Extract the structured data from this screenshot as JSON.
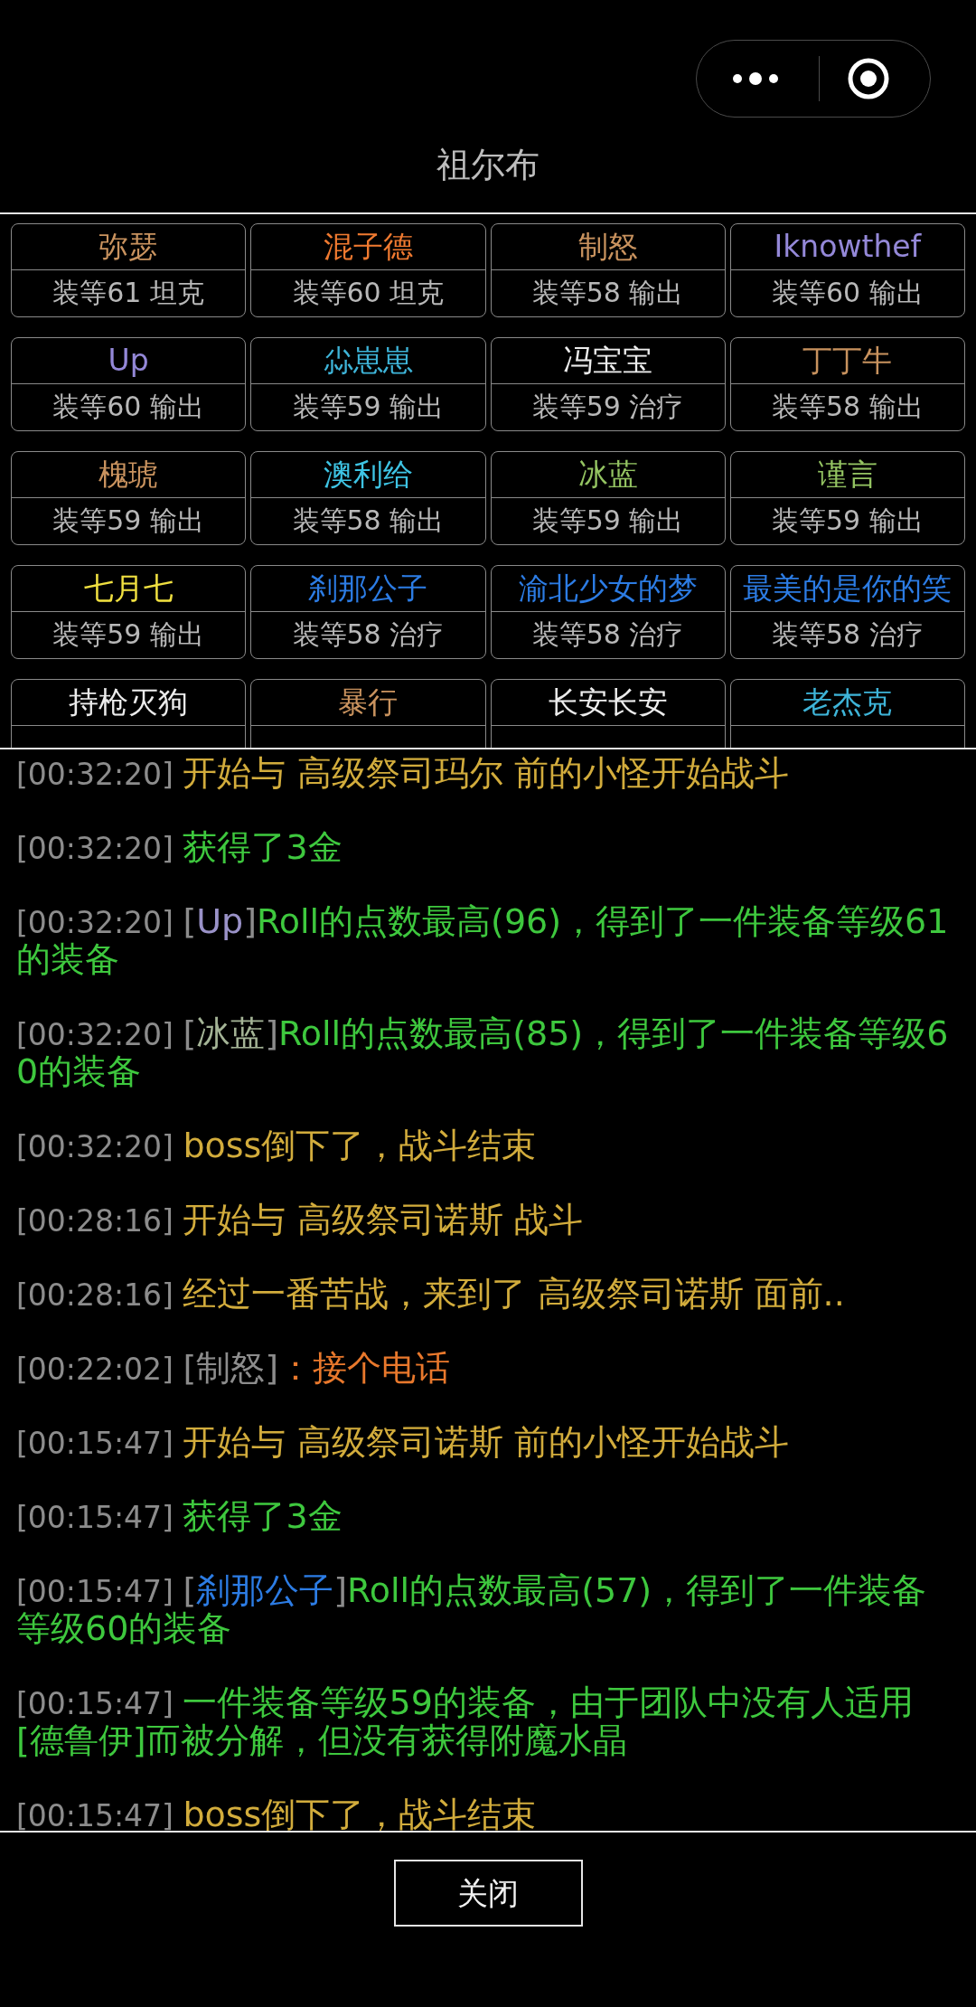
{
  "title": "祖尔布",
  "members": [
    {
      "name": "弥瑟",
      "color": "#c8925e",
      "info": "装等61 坦克"
    },
    {
      "name": "混子德",
      "color": "#f07a30",
      "info": "装等60 坦克"
    },
    {
      "name": "制怒",
      "color": "#c8925e",
      "info": "装等58 输出"
    },
    {
      "name": "Iknowthef",
      "color": "#9488d8",
      "info": "装等60 输出"
    },
    {
      "name": "Up",
      "color": "#9488d8",
      "info": "装等60 输出"
    },
    {
      "name": "尛崽崽",
      "color": "#3eb4d8",
      "info": "装等59 输出"
    },
    {
      "name": "冯宝宝",
      "color": "#ececec",
      "info": "装等59 治疗"
    },
    {
      "name": "丁丁牛",
      "color": "#c8925e",
      "info": "装等58 输出"
    },
    {
      "name": "槐琥",
      "color": "#c8925e",
      "info": "装等59 输出"
    },
    {
      "name": "澳利给",
      "color": "#3ec4e4",
      "info": "装等58 输出"
    },
    {
      "name": "冰蓝",
      "color": "#94c462",
      "info": "装等59 输出"
    },
    {
      "name": "谨言",
      "color": "#94c462",
      "info": "装等59 输出"
    },
    {
      "name": "七月七",
      "color": "#f0e040",
      "info": "装等59 输出"
    },
    {
      "name": "刹那公子",
      "color": "#2c7ce4",
      "info": "装等58 治疗"
    },
    {
      "name": "渝北少女的梦",
      "color": "#2c7ce4",
      "info": "装等58 治疗"
    },
    {
      "name": "最美的是你的笑",
      "color": "#2c7ce4",
      "info": "装等58 治疗"
    },
    {
      "name": "持枪灭狗",
      "color": "#ececec"
    },
    {
      "name": "暴行",
      "color": "#c8925e"
    },
    {
      "name": "长安长安",
      "color": "#ececec"
    },
    {
      "name": "老杰克",
      "color": "#3eb4d8"
    }
  ],
  "log": [
    {
      "time": "[00:32:20]",
      "parts": [
        {
          "text": "开始与 高级祭司玛尔 前的小怪开始战斗",
          "color": "#d2ac3c"
        }
      ]
    },
    {
      "time": "[00:32:20]",
      "parts": [
        {
          "text": "获得了3金",
          "color": "#3ec83e"
        }
      ]
    },
    {
      "time": "[00:32:20]",
      "parts": [
        {
          "text": "[",
          "color": "#8c8c8c"
        },
        {
          "text": "Up",
          "color": "#9a92c8"
        },
        {
          "text": "]",
          "color": "#8c8c8c"
        },
        {
          "text": "Roll的点数最高(96)，得到了一件装备等级61的装备",
          "color": "#3ec83e"
        }
      ]
    },
    {
      "time": "[00:32:20]",
      "parts": [
        {
          "text": "[",
          "color": "#8c8c8c"
        },
        {
          "text": "冰蓝",
          "color": "#a4b496"
        },
        {
          "text": "]",
          "color": "#8c8c8c"
        },
        {
          "text": "Roll的点数最高(85)，得到了一件装备等级60的装备",
          "color": "#3ec83e"
        }
      ]
    },
    {
      "time": "[00:32:20]",
      "parts": [
        {
          "text": "boss倒下了，战斗结束",
          "color": "#d2ac3c"
        }
      ]
    },
    {
      "time": "[00:28:16]",
      "parts": [
        {
          "text": "开始与 高级祭司诺斯 战斗",
          "color": "#d2ac3c"
        }
      ]
    },
    {
      "time": "[00:28:16]",
      "parts": [
        {
          "text": "经过一番苦战，来到了 高级祭司诺斯 面前..",
          "color": "#d2ac3c"
        }
      ]
    },
    {
      "time": "[00:22:02]",
      "parts": [
        {
          "text": "[制怒]",
          "color": "#8c8c8c"
        },
        {
          "text": "：接个电话",
          "color": "#e8782c"
        }
      ]
    },
    {
      "time": "[00:15:47]",
      "parts": [
        {
          "text": "开始与 高级祭司诺斯 前的小怪开始战斗",
          "color": "#d2ac3c"
        }
      ]
    },
    {
      "time": "[00:15:47]",
      "parts": [
        {
          "text": "获得了3金",
          "color": "#3ec83e"
        }
      ]
    },
    {
      "time": "[00:15:47]",
      "parts": [
        {
          "text": "[",
          "color": "#8c8c8c"
        },
        {
          "text": "刹那公子",
          "color": "#2c7ce4"
        },
        {
          "text": "]",
          "color": "#8c8c8c"
        },
        {
          "text": "Roll的点数最高(57)，得到了一件装备等级60的装备",
          "color": "#3ec83e"
        }
      ]
    },
    {
      "time": "[00:15:47]",
      "parts": [
        {
          "text": "一件装备等级59的装备，由于团队中没有人适用[德鲁伊]而被分解，但没有获得附魔水晶",
          "color": "#3ec83e"
        }
      ]
    },
    {
      "time": "[00:15:47]",
      "parts": [
        {
          "text": "boss倒下了，战斗结束",
          "color": "#d2ac3c"
        }
      ]
    }
  ],
  "close_button": "关闭"
}
